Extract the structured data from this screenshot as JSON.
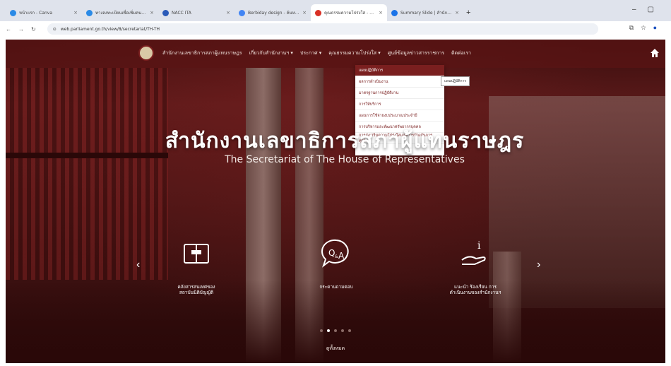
{
  "browser": {
    "tabs": [
      {
        "label": "หน้าแรก - Canva",
        "favicon_color": "#2a8ae6"
      },
      {
        "label": "ทางลงทะเบียนเพื่อเพิ่มคนเข้าถึงร...",
        "favicon_color": "#2a8ae6"
      },
      {
        "label": "NACC ITA",
        "favicon_color": "#2a5ab8"
      },
      {
        "label": "Berbiday design - ค้นหาด้วย Google",
        "favicon_color": "#4285f4"
      },
      {
        "label": "คุณธรรมความโปร่งใส - สำนักงานเลขาธิการสภา...",
        "favicon_color": "#d93025",
        "active": true
      },
      {
        "label": "Summary Slide | สำนักงานเลขาธิการ...",
        "favicon_color": "#1a73e8"
      }
    ],
    "new_tab": "+",
    "url": "web.parliament.go.th/view/8/secretariat/TH-TH"
  },
  "site": {
    "nav": [
      "สำนักงานเลขาธิการสภาผู้แทนราษฎร",
      "เกี่ยวกับสำนักงานฯ ▾",
      "ประกาศ ▾",
      "คุณธรรมความโปร่งใส ▾",
      "ศูนย์ข้อมูลข่าวสารราชการ",
      "ติดต่อเรา"
    ],
    "dropdown": [
      "แผนปฏิบัติการ",
      "ผลการดำเนินงาน",
      "มาตรฐานการปฏิบัติงาน",
      "การให้บริการ",
      "แผนการใช้จ่ายงบประมาณประจำปี",
      "การบริหารและพัฒนาทรัพยากรบุคคล",
      "การส่งเสริมความโปร่งใสและการป้องกันการทุจริต"
    ],
    "tooltip": "แผนปฏิบัติการ",
    "hero_title": "สำนักงานเลขาธิการสภาผู้แทนราษฎร",
    "hero_subtitle": "The Secretariat of The House of Representatives",
    "features": [
      {
        "label": "คลังสารสนเทศของ\nสถาบันนิติบัญญัติ",
        "icon": "law-book-icon"
      },
      {
        "label": "กระดานถามตอบ",
        "icon": "qa-bubble-icon"
      },
      {
        "label": "แนะนำ ร้องเรียน การ\nดำเนินงานของสำนักงานฯ",
        "icon": "info-hand-icon"
      }
    ],
    "see_all": "ดูทั้งหมด",
    "carousel": {
      "count": 5,
      "active": 1
    }
  },
  "colors": {
    "brand_maroon": "#7a1f1f",
    "nav_bg": "#5a1414"
  }
}
